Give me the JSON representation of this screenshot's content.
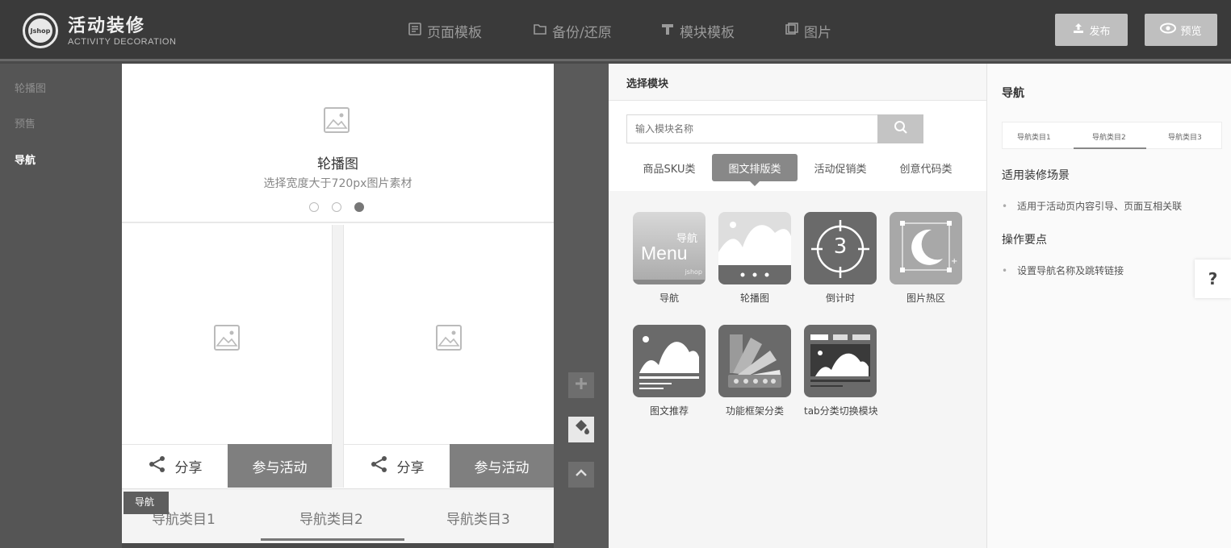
{
  "header": {
    "logo_text": "Jshop",
    "title": "活动装修",
    "subtitle": "ACTIVITY DECORATION",
    "nav": [
      {
        "label": "页面模板",
        "icon": "template-icon"
      },
      {
        "label": "备份/还原",
        "icon": "folder-icon"
      },
      {
        "label": "模块模板",
        "icon": "module-icon"
      },
      {
        "label": "图片",
        "icon": "image-icon"
      }
    ],
    "publish_label": "发布",
    "preview_label": "预览"
  },
  "sidebar": {
    "items": [
      {
        "label": "轮播图",
        "active": false
      },
      {
        "label": "预售",
        "active": false
      },
      {
        "label": "导航",
        "active": true
      }
    ]
  },
  "canvas": {
    "carousel": {
      "title": "轮播图",
      "subtitle": "选择宽度大于720px图片素材",
      "dot_count": 3,
      "active_dot": 2
    },
    "cards": [
      {
        "share_label": "分享",
        "join_label": "参与活动"
      },
      {
        "share_label": "分享",
        "join_label": "参与活动"
      }
    ],
    "nav_badge": "导航",
    "nav_tabs": [
      "导航类目1",
      "导航类目2",
      "导航类目3"
    ],
    "active_nav_tab": 1
  },
  "modules": {
    "header": "选择模块",
    "search_placeholder": "输入模块名称",
    "categories": [
      "商品SKU类",
      "图文排版类",
      "活动促销类",
      "创意代码类"
    ],
    "active_category": 1,
    "items": [
      {
        "label": "导航",
        "icon": "menu-module-icon",
        "icon_text_top": "导航",
        "icon_text_main": "Menu",
        "icon_text_small": "jshop"
      },
      {
        "label": "轮播图",
        "icon": "carousel-module-icon"
      },
      {
        "label": "倒计时",
        "icon": "countdown-module-icon",
        "icon_text_main": "3"
      },
      {
        "label": "图片热区",
        "icon": "hotspot-module-icon"
      },
      {
        "label": "图文推荐",
        "icon": "image-text-module-icon"
      },
      {
        "label": "功能框架分类",
        "icon": "framework-module-icon"
      },
      {
        "label": "tab分类切换模块",
        "icon": "tab-switch-module-icon"
      }
    ]
  },
  "right_panel": {
    "title": "导航",
    "tabs": [
      "导航类目1",
      "导航类目2",
      "导航类目3"
    ],
    "active_tab": 1,
    "scene_heading": "适用装修场景",
    "scene_items": [
      "适用于活动页内容引导、页面互相关联"
    ],
    "points_heading": "操作要点",
    "points_items": [
      "设置导航名称及跳转链接"
    ],
    "help_label": "?"
  },
  "colors": {
    "header_bg": "#3a3a3a",
    "sidebar_bg": "#555555",
    "accent": "#888888",
    "join_button": "#7f7f7f"
  }
}
